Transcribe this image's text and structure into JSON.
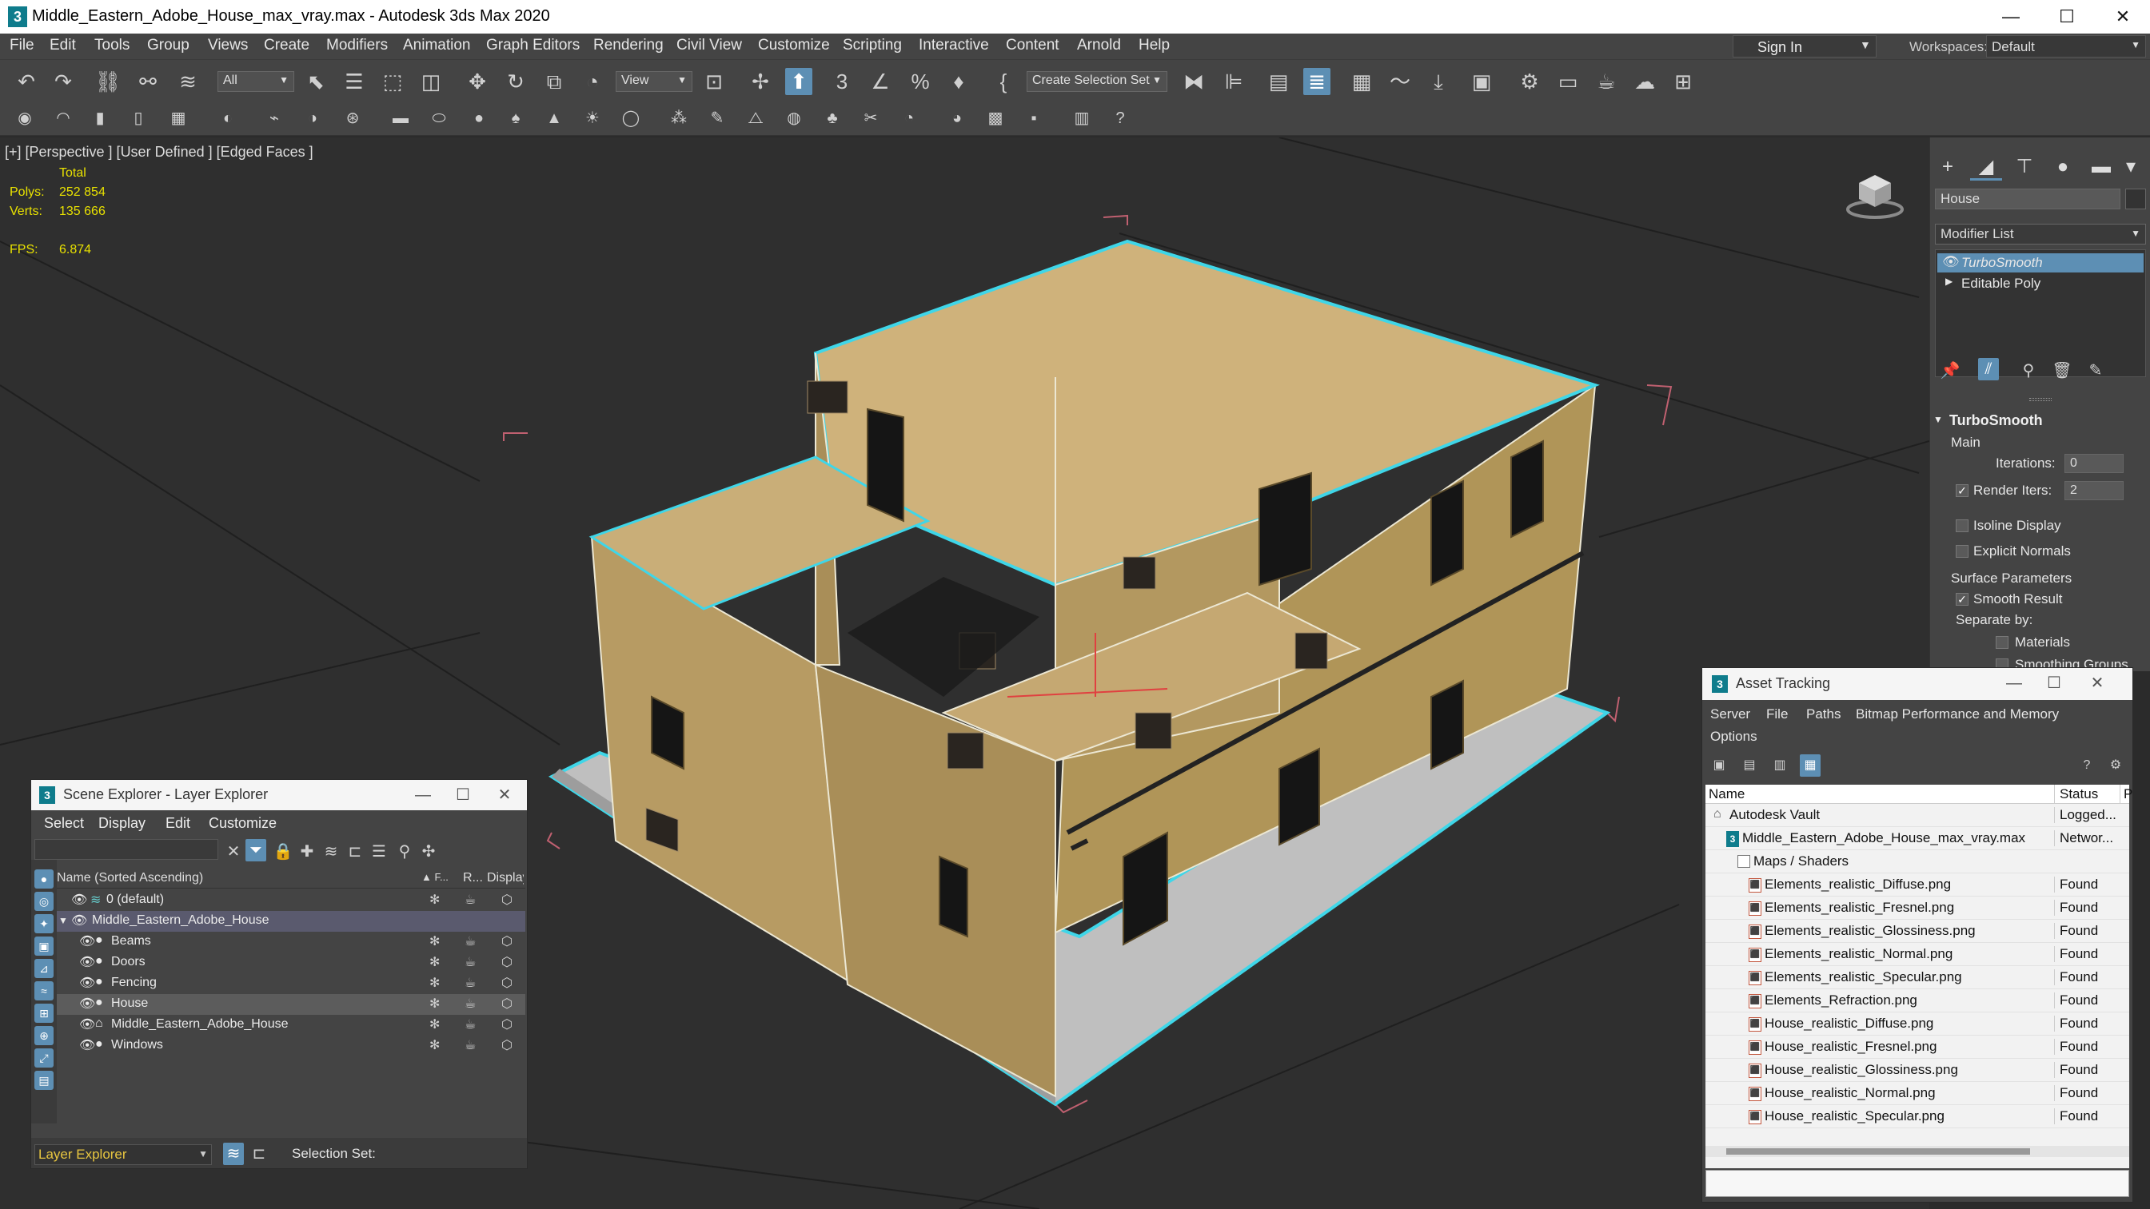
{
  "window": {
    "title": "Middle_Eastern_Adobe_House_max_vray.max - Autodesk 3ds Max 2020",
    "app_icon": "3",
    "minimize": "—",
    "maximize": "☐",
    "close": "✕"
  },
  "menubar": {
    "items": [
      "File",
      "Edit",
      "Tools",
      "Group",
      "Views",
      "Create",
      "Modifiers",
      "Animation",
      "Graph Editors",
      "Rendering",
      "Civil View",
      "Customize",
      "Scripting",
      "Interactive",
      "Content",
      "Arnold",
      "Help"
    ],
    "sign_in": "Sign In",
    "workspaces_label": "Workspaces:",
    "workspace_value": "Default"
  },
  "toolbar": {
    "selection_filter": "All",
    "ref_coord": "View",
    "selection_set": "Create Selection Set"
  },
  "viewport": {
    "label": "[+] [Perspective ] [User Defined ] [Edged Faces ]",
    "stats": {
      "total_label": "Total",
      "polys_label": "Polys:",
      "polys_value": "252 854",
      "verts_label": "Verts:",
      "verts_value": "135 666",
      "fps_label": "FPS:",
      "fps_value": "6.874"
    }
  },
  "command_panel": {
    "object_name": "House",
    "modifier_list": "Modifier List",
    "stack": [
      "TurboSmooth",
      "Editable Poly"
    ],
    "rollout_title": "TurboSmooth",
    "main_label": "Main",
    "iterations_label": "Iterations:",
    "iterations_value": "0",
    "render_iters_label": "Render Iters:",
    "render_iters_value": "2",
    "isoline_display": "Isoline Display",
    "explicit_normals": "Explicit Normals",
    "surface_params": "Surface Parameters",
    "smooth_result": "Smooth Result",
    "separate_by": "Separate by:",
    "materials": "Materials",
    "smoothing_groups": "Smoothing Groups"
  },
  "scene_explorer": {
    "title": "Scene Explorer - Layer Explorer",
    "menu": [
      "Select",
      "Display",
      "Edit",
      "Customize"
    ],
    "columns": {
      "name": "Name (Sorted Ascending)",
      "freeze": "▲ F...",
      "render": "R...",
      "display": "Display ..."
    },
    "rows": [
      {
        "name": "0 (default)"
      },
      {
        "name": "Middle_Eastern_Adobe_House"
      },
      {
        "name": "Beams"
      },
      {
        "name": "Doors"
      },
      {
        "name": "Fencing"
      },
      {
        "name": "House"
      },
      {
        "name": "Middle_Eastern_Adobe_House"
      },
      {
        "name": "Windows"
      }
    ],
    "footer_dropdown": "Layer Explorer",
    "selection_set_label": "Selection Set:"
  },
  "asset_tracking": {
    "title": "Asset Tracking",
    "menu_row1": [
      "Server",
      "File",
      "Paths",
      "Bitmap Performance and Memory"
    ],
    "menu_row2": [
      "Options"
    ],
    "columns": {
      "name": "Name",
      "status": "Status",
      "extra": "P"
    },
    "rows": [
      {
        "name": "Autodesk Vault",
        "status": "Logged..."
      },
      {
        "name": "Middle_Eastern_Adobe_House_max_vray.max",
        "status": "Networ..."
      },
      {
        "name": "Maps / Shaders",
        "status": ""
      },
      {
        "name": "Elements_realistic_Diffuse.png",
        "status": "Found"
      },
      {
        "name": "Elements_realistic_Fresnel.png",
        "status": "Found"
      },
      {
        "name": "Elements_realistic_Glossiness.png",
        "status": "Found"
      },
      {
        "name": "Elements_realistic_Normal.png",
        "status": "Found"
      },
      {
        "name": "Elements_realistic_Specular.png",
        "status": "Found"
      },
      {
        "name": "Elements_Refraction.png",
        "status": "Found"
      },
      {
        "name": "House_realistic_Diffuse.png",
        "status": "Found"
      },
      {
        "name": "House_realistic_Fresnel.png",
        "status": "Found"
      },
      {
        "name": "House_realistic_Glossiness.png",
        "status": "Found"
      },
      {
        "name": "House_realistic_Normal.png",
        "status": "Found"
      },
      {
        "name": "House_realistic_Specular.png",
        "status": "Found"
      }
    ]
  },
  "colors": {
    "accent": "#5d8fb4",
    "stats_text": "#e8e100",
    "layer_label": "#e8c640",
    "selection_outline": "#3fd6e8"
  }
}
